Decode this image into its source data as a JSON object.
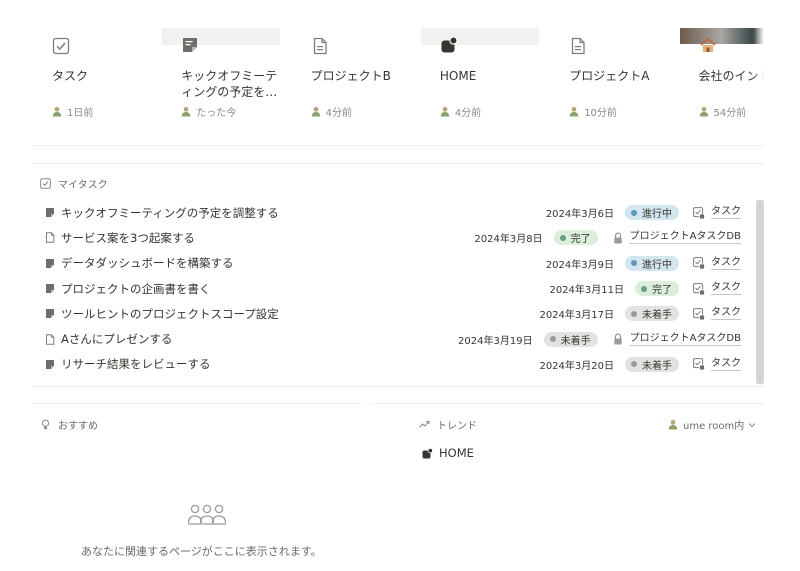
{
  "recent": [
    {
      "title": "タスク",
      "meta": "1日前",
      "icon": "checkbox-icon",
      "cover": false
    },
    {
      "title": "キックオフミーティングの予定を…",
      "meta": "たった今",
      "icon": "note-icon",
      "cover": true
    },
    {
      "title": "プロジェクトB",
      "meta": "4分前",
      "icon": "page-icon",
      "cover": false
    },
    {
      "title": "HOME",
      "meta": "4分前",
      "icon": "home-page-icon",
      "cover": true
    },
    {
      "title": "プロジェクトA",
      "meta": "10分前",
      "icon": "page-icon",
      "cover": false
    },
    {
      "title": "会社のイントイト",
      "meta": "54分前",
      "icon": "photo-cover-icon",
      "cover": true
    }
  ],
  "my_tasks": {
    "title": "マイタスク",
    "rows": [
      {
        "name": "キックオフミーティングの予定を調整する",
        "date": "2024年3月6日",
        "status": "進行中",
        "status_color": "#d3e5ef",
        "dot": "#5b97bd",
        "relation": "タスク",
        "icon": "note-icon"
      },
      {
        "name": "サービス案を3つ起案する",
        "date": "2024年3月8日",
        "status": "完了",
        "status_color": "#dbeddb",
        "dot": "#6c9b7d",
        "relation": "プロジェクトAタスクDB",
        "icon": "page-icon"
      },
      {
        "name": "データダッシュボードを構築する",
        "date": "2024年3月9日",
        "status": "進行中",
        "status_color": "#d3e5ef",
        "dot": "#5b97bd",
        "relation": "タスク",
        "icon": "note-icon"
      },
      {
        "name": "プロジェクトの企画書を書く",
        "date": "2024年3月11日",
        "status": "完了",
        "status_color": "#dbeddb",
        "dot": "#6c9b7d",
        "relation": "タスク",
        "icon": "note-icon"
      },
      {
        "name": "ツールヒントのプロジェクトスコープ設定",
        "date": "2024年3月17日",
        "status": "未着手",
        "status_color": "#e3e2e0",
        "dot": "#9b9a97",
        "relation": "タスク",
        "icon": "note-icon"
      },
      {
        "name": "Aさんにプレゼンする",
        "date": "2024年3月19日",
        "status": "未着手",
        "status_color": "#e3e2e0",
        "dot": "#9b9a97",
        "relation": "プロジェクトAタスクDB",
        "icon": "page-icon"
      },
      {
        "name": "リサーチ結果をレビューする",
        "date": "2024年3月20日",
        "status": "未着手",
        "status_color": "#e3e2e0",
        "dot": "#9b9a97",
        "relation": "タスク",
        "icon": "note-icon"
      }
    ]
  },
  "recommend": {
    "title": "おすすめ",
    "empty": "あなたに関連するページがここに表示されます。"
  },
  "trend": {
    "title": "トレンド",
    "workspace": "ume room内",
    "item": "HOME"
  }
}
